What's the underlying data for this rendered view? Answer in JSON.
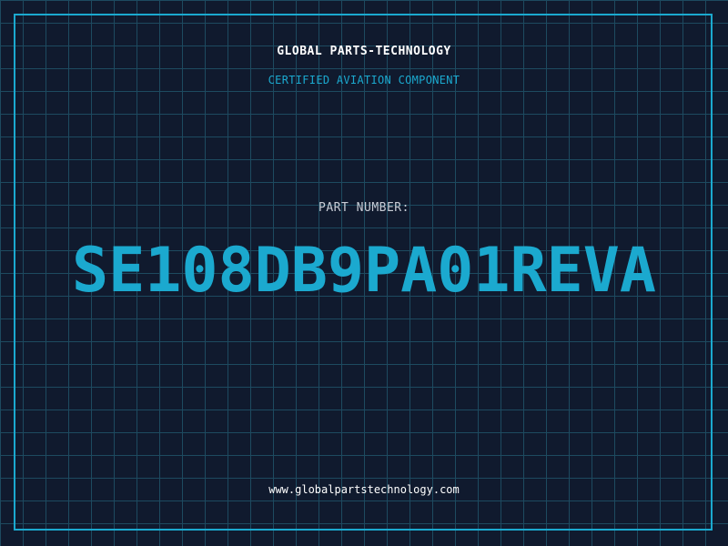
{
  "header": {
    "company": "GLOBAL PARTS-TECHNOLOGY",
    "subtitle": "CERTIFIED AVIATION COMPONENT"
  },
  "part": {
    "label": "PART NUMBER:",
    "number": "SE108DB9PA01REVA"
  },
  "footer": {
    "website": "www.globalpartstechnology.com"
  },
  "colors": {
    "background": "#101a2e",
    "grid": "#1d4a60",
    "accent": "#1ba9cf",
    "text": "#ffffff",
    "muted": "#c8cdd6"
  }
}
